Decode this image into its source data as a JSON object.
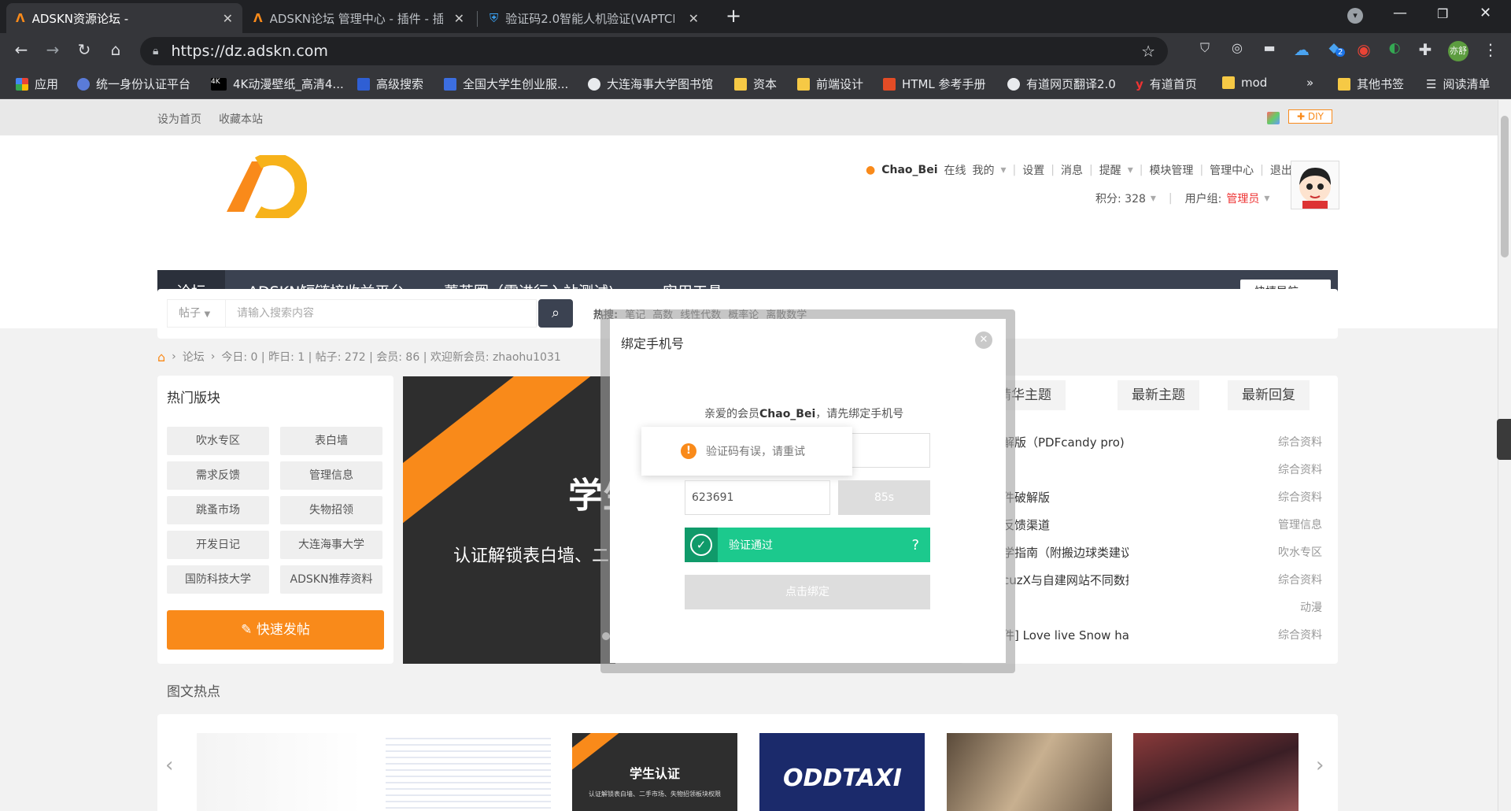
{
  "browser": {
    "tabs": [
      {
        "title": "ADSKN资源论坛 -",
        "active": true
      },
      {
        "title": "ADSKN论坛 管理中心 - 插件 - 插",
        "active": false
      },
      {
        "title": "验证码2.0智能人机验证(VAPTCHA",
        "active": false
      }
    ],
    "new_tab": "+",
    "url": "https://dz.adskn.com",
    "profile_badge": "亦舒",
    "ext_badge": "2",
    "bookmarks": [
      "应用",
      "统一身份认证平台",
      "4K动漫壁纸_高清4...",
      "高级搜索",
      "全国大学生创业服...",
      "大连海事大学图书馆",
      "资本",
      "前端设计",
      "HTML 参考手册",
      "有道网页翻译2.0",
      "有道首页",
      "mod"
    ],
    "bookmarks_more": "»",
    "other_bookmarks": "其他书签",
    "reading_list": "阅读清单"
  },
  "topbar": {
    "set_home": "设为首页",
    "bookmark_site": "收藏本站",
    "diy": "DIY"
  },
  "user": {
    "name": "Chao_Bei",
    "status": "在线",
    "links": [
      "我的",
      "设置",
      "消息",
      "提醒",
      "模块管理",
      "管理中心",
      "退出"
    ],
    "points_label": "积分: 328",
    "group_label": "用户组: ",
    "group": "管理员"
  },
  "nav": {
    "items": [
      "论坛",
      "ADSKN短链接收益平台",
      "菁英圈（需进行入站测试)",
      "实用工具"
    ],
    "quick_nav": "快捷导航"
  },
  "search": {
    "type": "帖子",
    "placeholder": "请输入搜索内容",
    "hot_label": "热搜:",
    "hot": [
      "笔记",
      "高数",
      "线性代数",
      "概率论",
      "离散数学"
    ]
  },
  "breadcrumb": {
    "forum": "论坛",
    "stats": "今日: 0 | 昨日: 1 | 帖子: 272 | 会员: 86 | 欢迎新会员: zhaohu1031"
  },
  "hot_boards": {
    "title": "热门版块",
    "items": [
      "吹水专区",
      "表白墙",
      "需求反馈",
      "管理信息",
      "跳蚤市场",
      "失物招领",
      "开发日记",
      "大连海事大学",
      "国防科技大学",
      "ADSKN推荐资料"
    ],
    "post_button": "快速发帖"
  },
  "banner": {
    "title": "学生",
    "subtitle": "认证解锁表白墙、二"
  },
  "thread_tabs": [
    "精华主题",
    "最新主题",
    "最新回复"
  ],
  "threads": [
    {
      "title": "解版（PDFcandy pro)",
      "board": "综合资料"
    },
    {
      "title": "",
      "board": "综合资料"
    },
    {
      "title": "件破解版",
      "board": "综合资料"
    },
    {
      "title": "反馈渠道",
      "board": "管理信息"
    },
    {
      "title": "学指南（附搬边球类建议)",
      "board": "吹水专区"
    },
    {
      "title": "cuzX与自建网站不同数据",
      "board": "综合资料"
    },
    {
      "title": "",
      "board": "动漫"
    },
    {
      "title": "件] Love live Snow hala",
      "board": "综合资料"
    }
  ],
  "gallery": {
    "title": "图文热点",
    "student_card_title": "学生认证",
    "student_card_sub": "认证解锁表白墙、二手市场、失物招领板块权限",
    "oddtaxi": "ODDTAXI"
  },
  "modal": {
    "title": "绑定手机号",
    "greeting_prefix": "亲爱的会员",
    "greeting_user": "Chao_Bei",
    "greeting_suffix": "，请先绑定手机号",
    "toast": "验证码有误，请重试",
    "code_value": "623691",
    "countdown": "85s",
    "verify_text": "验证通过",
    "verify_help": "?",
    "bind_button": "点击绑定"
  },
  "colors": {
    "accent_orange": "#f98a1a",
    "nav_bg": "#3b4251",
    "verify_green": "#1cc98d",
    "group_red": "#e33"
  }
}
